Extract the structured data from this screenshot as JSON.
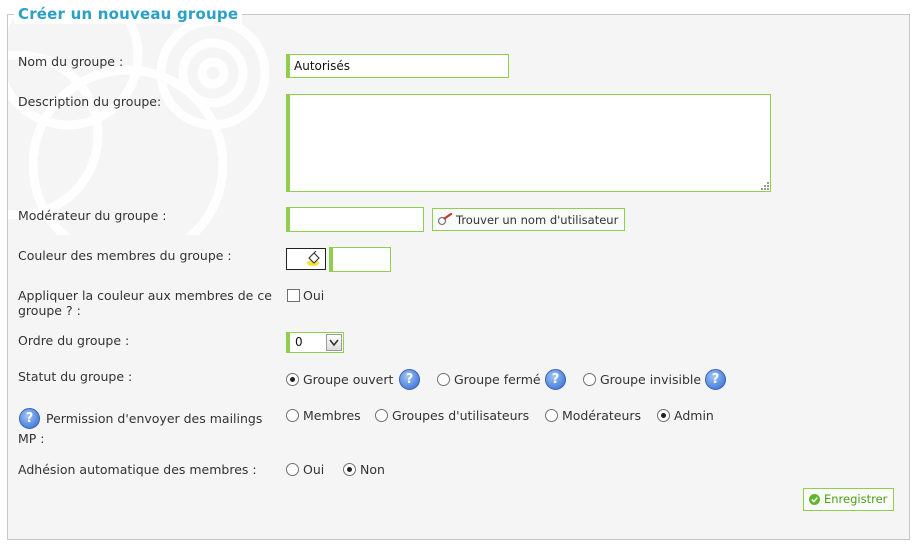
{
  "form": {
    "title": "Créer un nouveau groupe",
    "name_label": "Nom du groupe :",
    "name_value": "Autorisés",
    "description_label": "Description du groupe:",
    "description_value": "",
    "moderator_label": "Modérateur du groupe :",
    "moderator_value": "",
    "find_user_button": "Trouver un nom d'utilisateur",
    "color_label": "Couleur des membres du groupe :",
    "color_value": "",
    "apply_color_label_1": "Appliquer la couleur aux membres de ce",
    "apply_color_label_2": "groupe ? :",
    "apply_color_option": "Oui",
    "apply_color_checked": false,
    "order_label": "Ordre du groupe :",
    "order_value": "0",
    "status_label": "Statut du groupe :",
    "status_options": [
      "Groupe ouvert",
      "Groupe fermé",
      "Groupe invisible"
    ],
    "status_selected": "Groupe ouvert",
    "mailing_label_1": "Permission d'envoyer des mailings",
    "mailing_label_2": "MP :",
    "mailing_options": [
      "Membres",
      "Groupes d'utilisateurs",
      "Modérateurs",
      "Admin"
    ],
    "mailing_selected": "Admin",
    "auto_join_label": "Adhésion automatique des membres :",
    "auto_join_options": [
      "Oui",
      "Non"
    ],
    "auto_join_selected": "Non",
    "save_button": "Enregistrer"
  },
  "icons": {
    "help": "help-icon",
    "find_user": "magnifier-icon",
    "color_picker": "paint-bucket-icon",
    "save": "checkmark-icon"
  },
  "colors": {
    "accent_title": "#2aa0c6",
    "input_border": "#8fcf4d",
    "save_text": "#4e9f12",
    "panel_bg": "#f5f5f5"
  }
}
